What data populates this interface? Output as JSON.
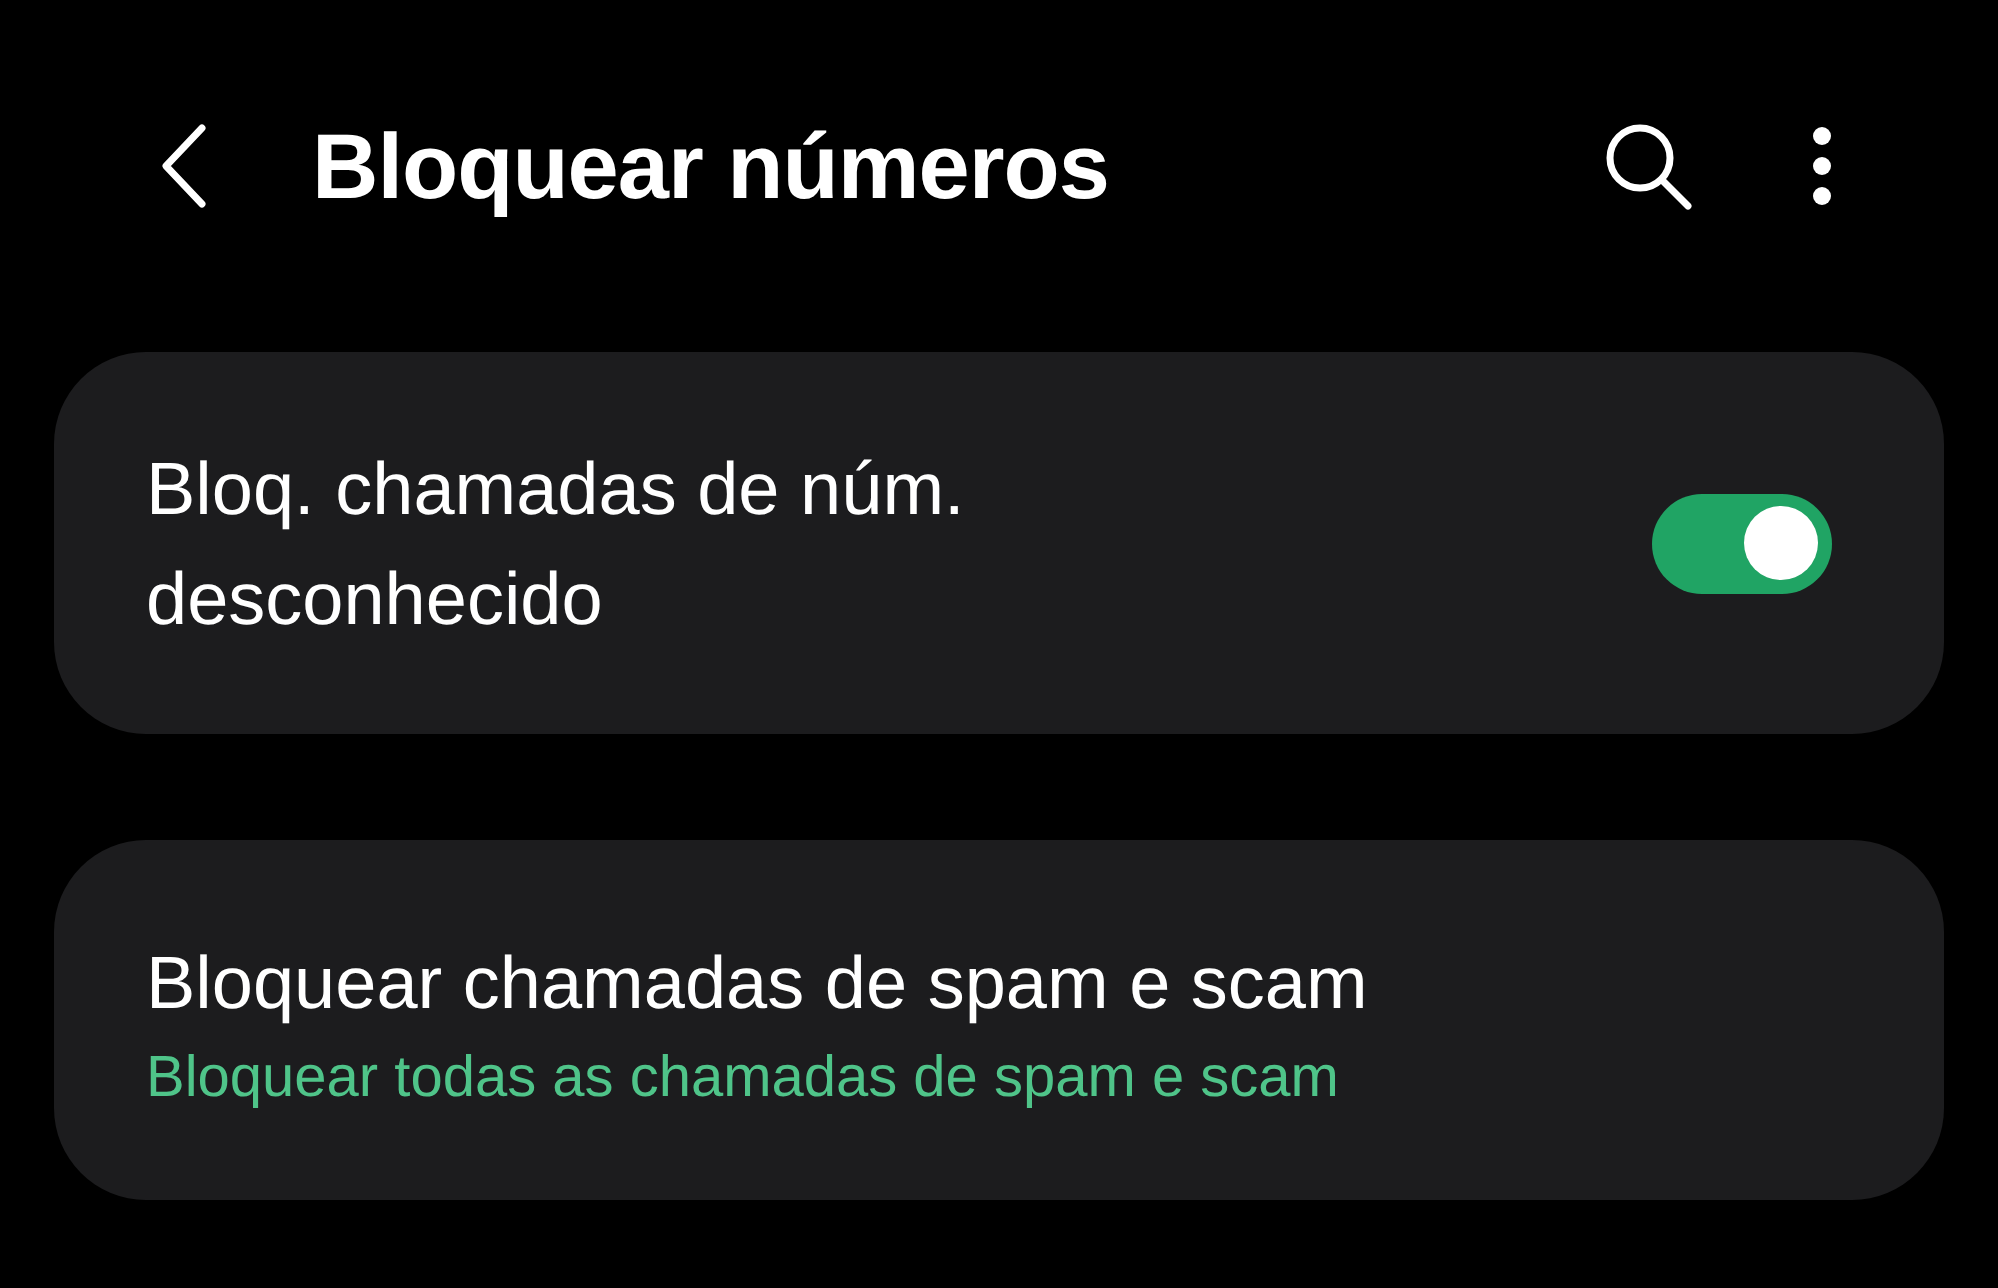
{
  "header": {
    "title": "Bloquear números"
  },
  "settings": [
    {
      "kind": "toggle",
      "label": "Bloq. chamadas de núm. desconhecido",
      "on": true
    },
    {
      "kind": "link",
      "label": "Bloquear chamadas de spam e scam",
      "summary": "Bloquear todas as chamadas de spam e scam"
    }
  ]
}
